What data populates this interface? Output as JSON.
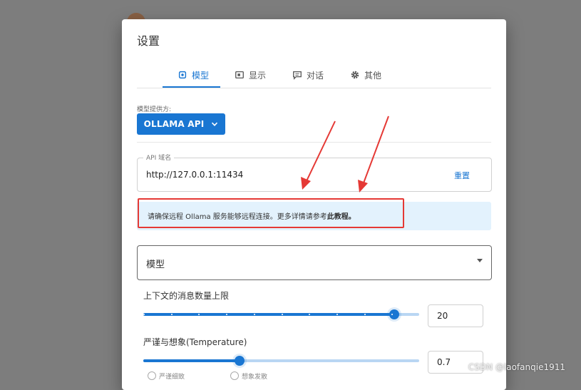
{
  "dialog": {
    "title": "设置"
  },
  "tabs": [
    {
      "label": "模型",
      "icon": "model-icon",
      "active": true
    },
    {
      "label": "显示",
      "icon": "display-icon",
      "active": false
    },
    {
      "label": "对话",
      "icon": "chat-icon",
      "active": false
    },
    {
      "label": "其他",
      "icon": "gear-icon",
      "active": false
    }
  ],
  "provider": {
    "label": "模型提供方:",
    "value": "OLLAMA API"
  },
  "api": {
    "legend": "API 域名",
    "value": "http://127.0.0.1:11434",
    "reset_label": "重置"
  },
  "info": {
    "text": "请确保远程 Ollama 服务能够远程连接。更多详情请参考",
    "link_text": "此教程。"
  },
  "model": {
    "placeholder": "模型"
  },
  "context_slider": {
    "label": "上下文的消息数量上限",
    "value": "20",
    "fraction": 0.91,
    "ticks": 11
  },
  "temperature_slider": {
    "label": "严谨与想象(Temperature)",
    "value": "0.7",
    "fraction": 0.35
  },
  "chips": [
    {
      "label": "严谨细致"
    },
    {
      "label": "想象发散"
    }
  ],
  "watermark": "CSDN @laofanqie1911",
  "colors": {
    "accent": "#1976d2",
    "highlight": "#e53935",
    "banner": "#e3f2fd"
  }
}
